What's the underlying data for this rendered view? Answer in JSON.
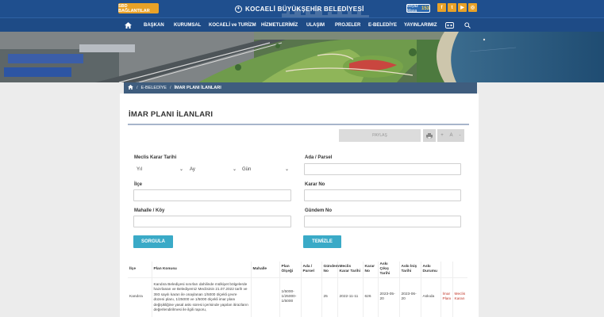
{
  "header": {
    "sbd_button": "SBD BAĞLANTILAR",
    "brand_title": "KOCAELİ BÜYÜKŞEHİR BELEDİYESİ",
    "phone_label": "Beyaz Masa",
    "phone_number": "153",
    "social": [
      "f",
      "t",
      "▶",
      "◎"
    ],
    "accent_color": "#e9a227",
    "bar_color": "#1f4f8e"
  },
  "nav": {
    "home_icon": "home-icon",
    "items": [
      "BAŞKAN",
      "KURUMSAL",
      "KOCAELİ ve TURİZM",
      "HİZMETLERİMİZ",
      "ULAŞIM",
      "PROJELER",
      "E-BELEDİYE",
      "YAYINLARIMIZ"
    ],
    "search_icon": "search-icon"
  },
  "breadcrumb": {
    "items": [
      "E-BELEDİYE",
      "İMAR PLANI İLANLARI"
    ]
  },
  "page": {
    "title": "İMAR PLANI İLANLARI",
    "share_label": "PAYLAŞ",
    "tools": [
      "🖶",
      "+",
      "A",
      "-"
    ]
  },
  "form": {
    "meclis_label": "Meclis Karar Tarihi",
    "year_select": "Yıl",
    "month_select": "Ay",
    "day_select": "Gün",
    "ada_label": "Ada / Parsel",
    "ada_value": "",
    "ilce_label": "İlçe",
    "ilce_value": "",
    "karar_label": "Karar No",
    "karar_value": "",
    "mahalle_label": "Mahalle / Köy",
    "mahalle_value": "",
    "gundem_label": "Gündem No",
    "gundem_value": "",
    "search_button": "SORGULA",
    "clear_button": "TEMİZLE"
  },
  "table": {
    "headers": [
      "İlçe",
      "Plan Konusu",
      "Mahalle",
      "Plan Ölçeği",
      "Ada / Parsel",
      "Gündem No",
      "Meclis Karar Tarihi",
      "Karar No",
      "Askı Çıkış Tarihi",
      "Askı İniş Tarihi",
      "Askı Durumu",
      "",
      ""
    ],
    "rows": [
      {
        "ilce": "Kandıra",
        "konu": "Kandıra Belediyesi sınırları dahilinde mülkiyet bölgelerde hazırlanan ve Belediyemiz Meclisinin 21.07.2022 tarih ve 393 sayılı kararı ile onaylanan 1/5000 ölçekli çevre düzeni planı, 1/25000 ve 1/5000 ölçekli imar planı değişikliğine yasal askı süresi içerisinde yapılan itirazların değerlendirilmesi ile ilgili raporu,",
        "mahalle": "",
        "olcek": "1/5000-1/25000-1/5000",
        "ada": "",
        "gundem": "25",
        "tarih": "2022-11-11",
        "karar": "626",
        "aski_cikis": "2023-05-20",
        "aski_inis": "2023-06-20",
        "durum": "Askıda",
        "link1": "İmar Planı",
        "link2": "Meclis Kararı"
      }
    ]
  }
}
